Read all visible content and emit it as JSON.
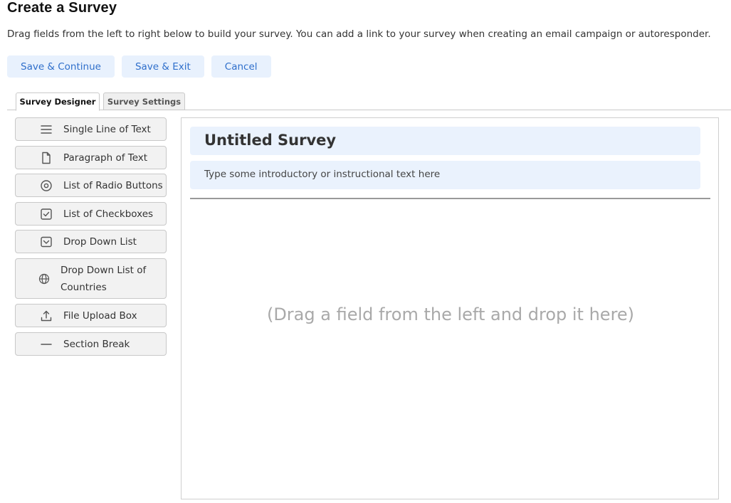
{
  "page": {
    "title": "Create a Survey",
    "description": "Drag fields from the left to right below to build your survey. You can add a link to your survey when creating an email campaign or autoresponder."
  },
  "actions": {
    "save_continue": "Save & Continue",
    "save_exit": "Save & Exit",
    "cancel": "Cancel"
  },
  "tabs": [
    {
      "label": "Survey Designer",
      "active": true
    },
    {
      "label": "Survey Settings",
      "active": false
    }
  ],
  "palette": [
    {
      "label": "Single Line of Text",
      "icon": "lines-icon"
    },
    {
      "label": "Paragraph of Text",
      "icon": "document-icon"
    },
    {
      "label": "List of Radio Buttons",
      "icon": "radio-icon"
    },
    {
      "label": "List of Checkboxes",
      "icon": "checkbox-icon"
    },
    {
      "label": "Drop Down List",
      "icon": "dropdown-icon"
    },
    {
      "label": "Drop Down List of Countries",
      "icon": "globe-icon"
    },
    {
      "label": "File Upload Box",
      "icon": "upload-icon"
    },
    {
      "label": "Section Break",
      "icon": "dash-icon"
    }
  ],
  "canvas": {
    "survey_title": "Untitled Survey",
    "intro_text": "Type some introductory or instructional text here",
    "drop_hint": "(Drag a field from the left and drop it here)"
  },
  "colors": {
    "accent": "#2f6fcb",
    "button_bg": "#e8f1fd",
    "header_bg": "#eaf2fd"
  }
}
